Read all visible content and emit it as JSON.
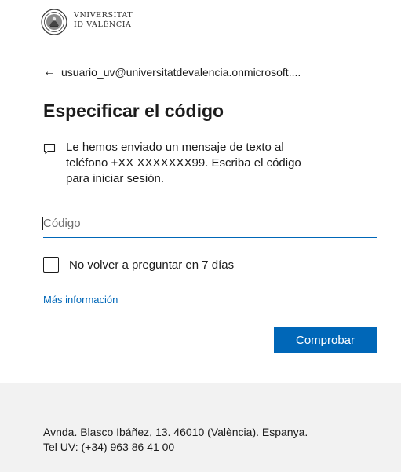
{
  "logo": {
    "line1": "VNIVERSITAT",
    "line2": "ID VALÈNCIA"
  },
  "account": {
    "back_icon": "arrow-left-icon",
    "email": "usuario_uv@universitatdevalencia.onmicrosoft...."
  },
  "page": {
    "title": "Especificar el código"
  },
  "message": {
    "icon": "chat-bubble-icon",
    "text": "Le hemos enviado un mensaje de texto al teléfono +XX XXXXXXX99. Escriba el código para iniciar sesión."
  },
  "code_input": {
    "value": "",
    "placeholder": "Código"
  },
  "remember": {
    "checked": false,
    "label": "No volver a preguntar en 7 días"
  },
  "more_info": {
    "label": "Más información"
  },
  "verify_button": {
    "label": "Comprobar"
  },
  "colors": {
    "accent": "#0067b8",
    "footer_bg": "#f2f2f2"
  },
  "footer": {
    "address": "Avnda. Blasco Ibáñez, 13. 46010 (València). Espanya.",
    "phone": "Tel UV: (+34) 963 86 41 00"
  }
}
